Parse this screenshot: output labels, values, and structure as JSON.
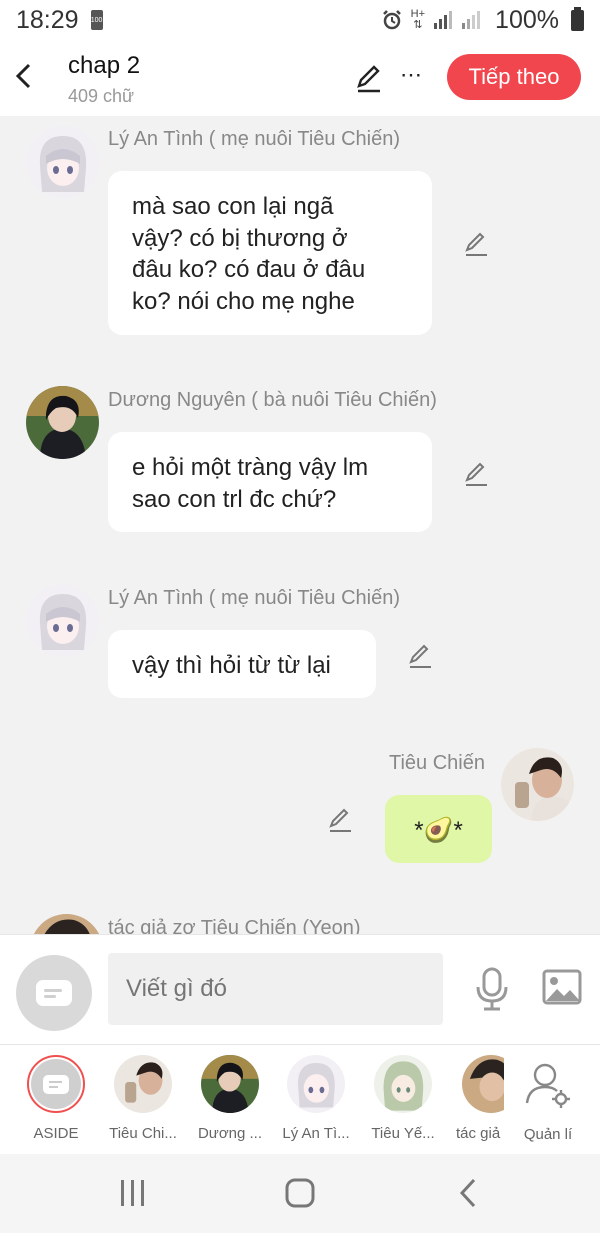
{
  "status_bar": {
    "time": "18:29",
    "battery_small": "100",
    "network": "H+",
    "battery_pct": "100%"
  },
  "header": {
    "title": "chap 2",
    "word_count": "409 chữ",
    "next_label": "Tiếp theo",
    "more_label": "⋯"
  },
  "colors": {
    "accent": "#f2464f",
    "own_bubble": "#dff7a6",
    "name_gray": "#888888"
  },
  "messages": [
    {
      "author": "Lý An Tình ( mẹ nuôi Tiêu Chiến)",
      "lines": [
        "mà sao con lại ngã",
        "vậy? có bị thương ở",
        "đâu ko? có đau ở đâu",
        "ko? nói cho mẹ nghe"
      ],
      "side": "left",
      "avatar": "anime-girl-white-hair"
    },
    {
      "author": "Dương Nguyên ( bà nuôi Tiêu Chiến)",
      "lines": [
        "e hỏi một tràng vậy lm",
        "sao con trl đc chứ?"
      ],
      "side": "left",
      "avatar": "dark-hair-man"
    },
    {
      "author": "Lý An Tình ( mẹ nuôi Tiêu Chiến)",
      "lines": [
        "vậy thì hỏi từ từ lại"
      ],
      "side": "left",
      "avatar": "anime-girl-white-hair"
    },
    {
      "author": "Tiêu Chiến",
      "lines": [
        "*🥑*"
      ],
      "side": "right",
      "avatar": "man-photo"
    },
    {
      "author": "tác giả  zơ Tiêu Chiến (Yeon)",
      "lines": [],
      "side": "left",
      "avatar": "partial"
    }
  ],
  "composer": {
    "placeholder": "Viết gì đó"
  },
  "characters": [
    {
      "label": "ASIDE",
      "type": "aside"
    },
    {
      "label": "Tiêu Chi...",
      "type": "photo"
    },
    {
      "label": "Dương ...",
      "type": "photo"
    },
    {
      "label": "Lý An Tì...",
      "type": "anime"
    },
    {
      "label": "Tiêu Yế...",
      "type": "anime"
    },
    {
      "label": "tác giả",
      "type": "photo"
    },
    {
      "label": "Quản lí",
      "type": "manage"
    }
  ]
}
